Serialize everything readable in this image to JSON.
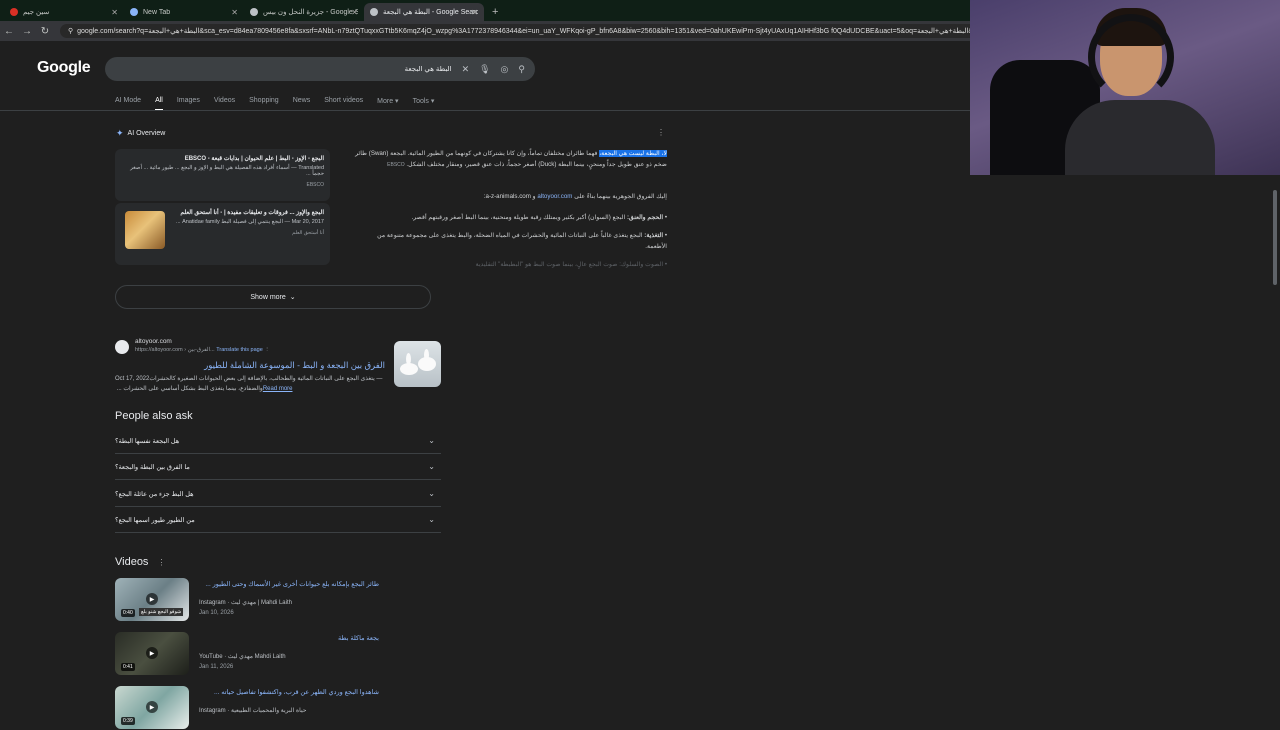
{
  "browser": {
    "tabs": [
      {
        "title": "سين جيم",
        "color": "#d93025"
      },
      {
        "title": "New Tab",
        "color": "#8ab4f8"
      },
      {
        "title": "جزيرة النحل ون بيس - Google Search",
        "color": "#bdc1c6"
      },
      {
        "title": "البطة هي البجعة - Google Search",
        "color": "#bdc1c6"
      }
    ],
    "new_tab_icon": "+",
    "url": "google.com/search?q=البطة+هي+البجعة&sca_esv=d84ea7809456e8fa&sxsrf=ANbL-n79ztQTuqxxGTtb5K6mqZ4jO_wzpg%3A1772378946344&ei=un_uaY_WFKqoi-gP_bfn6A8&biw=2560&bih=1351&ved=0ahUKEwiPm-Sjt4yUAxUq1AIHHf3bG f0Q4dUDCBE&uact=5&oq=البطة+هي+البجعة&gs"
  },
  "search": {
    "logo": "Google",
    "query": "البطة هي البجعة",
    "tabs": [
      "AI Mode",
      "All",
      "Images",
      "Videos",
      "Shopping",
      "News",
      "Short videos",
      "More",
      "Tools"
    ]
  },
  "ai_overview": {
    "label": "AI Overview",
    "cards": [
      {
        "title": "البجع - الإوز - البط | علم الحيوان | بدايات قبعة - EBSCO",
        "snippet": "Translated — أسماء أفراد هذه الفصيلة هي البط و الإوز و البجع ... طيور مائية ... أصغر حجماً ...",
        "source": "EBSCO"
      },
      {
        "title": "البجع والإوز ... فروقات و تعليقات مفيدة | - أنا أستحق العلم",
        "snippet": "Mar 20, 2017 — البجع ينتمي إلى فصيلة البط Anatidae family ...",
        "source": "أنا أستحق العلم"
      }
    ],
    "para1_highlight": "لا، البطة ليست هي البجعة،",
    "para1_rest": " فهما طائران مختلفان تماماً، وإن كانا يشتركان في كونهما من الطيور المائية. البجعة (Swan) طائر ضخم ذو عنق طويل جداً ومنحنٍ، بينما البطة (Duck) أصغر حجماً، ذات عنق قصير، ومنقار مختلف الشكل.",
    "para1_source": "EBSCO",
    "intro": "إليك الفروق الجوهرية بينهما بناءً على",
    "link1": "altoyoor.com",
    "and": "و",
    "link2": "a-z-animals.com",
    "bullet1_label": "الحجم والعنق:",
    "bullet1": " البجع (السوان) أكبر بكثير ويمتلك رقبة طويلة ومنحنية، بينما البط أصغر ورقبتهم أقصر.",
    "bullet2_label": "التغذية:",
    "bullet2": " البجع يتغذى غالباً على النباتات المائية والحشرات في المياه الضحلة، والبط يتغذى على مجموعة متنوعة من الأطعمة.",
    "bullet3": "الصوت والسلوك: صوت البجع عالٍ، بينما صوت البط هو \"البطبطة\" التقليدية",
    "show_more": "Show more"
  },
  "result": {
    "site": "altoyoor.com",
    "crumb": "https://altoyoor.com › الفرق-بين...",
    "translate": "Translate this page",
    "title": "الفرق بين البجعة و البط - الموسوعة الشاملة للطيور",
    "date": "Oct 17, 2022",
    "snippet": " — يتغذى البجع على النباتات المائية والطحالب، بالإضافة إلى بعض الحيوانات الصغيرة كالحشرات والضفادع، بينما يتغذى البط بشكل أساسي على الحشرات ... ",
    "read_more": "Read more"
  },
  "paa": {
    "title": "People also ask",
    "questions": [
      "هل البجعة نفسها البطة؟",
      "ما الفرق بين البطة والبجعة؟",
      "هل البط جزء من عائلة البجع؟",
      "من الطيور طيور اسمها البجع؟"
    ]
  },
  "videos": {
    "title": "Videos",
    "items": [
      {
        "title": "طائر البجع بإمكانه بلع حيوانات أخرى غير الأسماك وحتى الطيور ...",
        "channel": "Instagram · مهدي ليث | Mahdi Laith",
        "date": "Jan 10, 2026",
        "duration": "0:40",
        "caption": "شوفو البجع شنو بلع",
        "color": "#6b7f86"
      },
      {
        "title": "بجعة ماكلة بطة",
        "channel": "YouTube · مهدي ليث Mahdi Laith",
        "date": "Jan 11, 2026",
        "duration": "0:41",
        "caption": "",
        "color": "#3b3f35"
      },
      {
        "title": "شاهدوا البجع وردي الظهر عن قرب، واكتشفوا تفاصيل حياته ...",
        "channel": "Instagram · حياة البرية والمحميات الطبيعية",
        "date": "",
        "duration": "0:39",
        "caption": "",
        "color": "#7fa6a2"
      }
    ]
  }
}
